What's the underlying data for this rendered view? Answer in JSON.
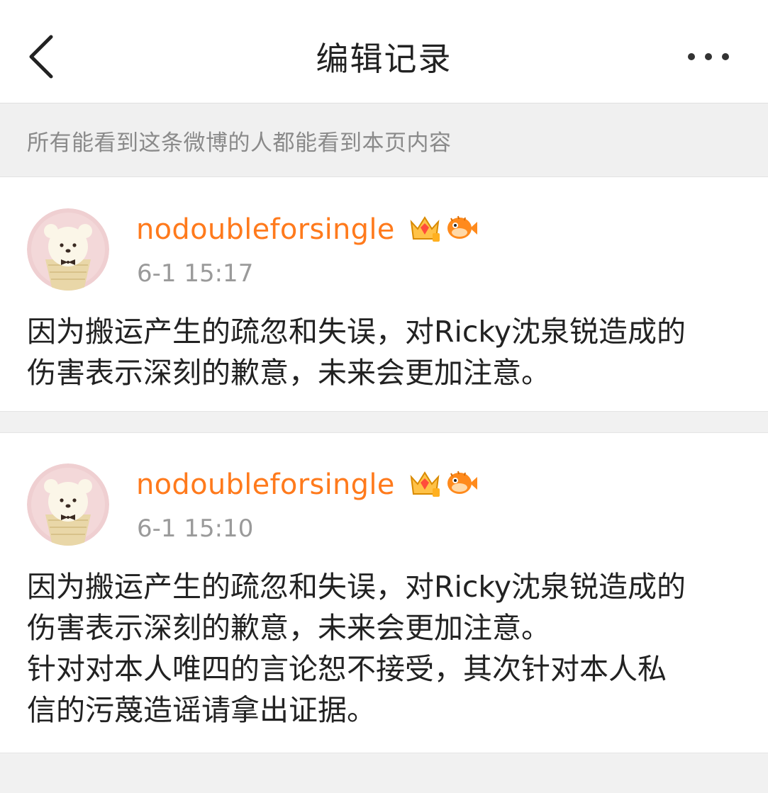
{
  "header": {
    "title": "编辑记录"
  },
  "notice": {
    "text": "所有能看到这条微博的人都能看到本页内容"
  },
  "entries": [
    {
      "username": "nodoubleforsingle",
      "timestamp": "6-1 15:17",
      "content_lines": [
        "因为搬运产生的疏忽和失误，对Ricky沈泉锐造成的",
        "伤害表示深刻的歉意，未来会更加注意。"
      ]
    },
    {
      "username": "nodoubleforsingle",
      "timestamp": "6-1 15:10",
      "content_lines": [
        "因为搬运产生的疏忽和失误，对Ricky沈泉锐造成的",
        "伤害表示深刻的歉意，未来会更加注意。",
        "针对对本人唯四的言论恕不接受，其次针对本人私",
        "信的污蔑造谣请拿出证据。"
      ]
    }
  ],
  "colors": {
    "username": "#ff7a1c",
    "timestamp": "#9a9a9a",
    "text": "#222222",
    "background": "#f1f1f1"
  },
  "icons": [
    "back-chevron-icon",
    "more-dots-icon",
    "crown-vip-icon",
    "pufferfish-badge-icon",
    "bear-avatar"
  ]
}
